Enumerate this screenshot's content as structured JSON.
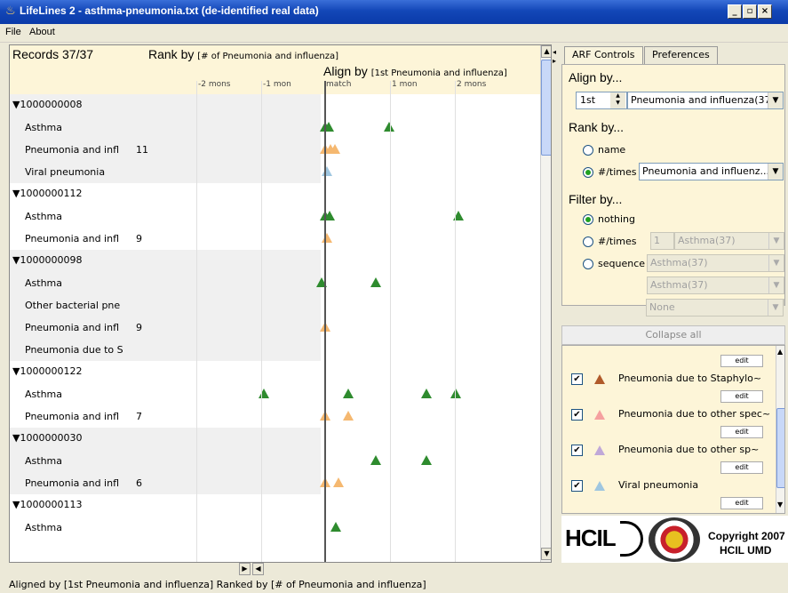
{
  "window": {
    "title": "LifeLines 2 - asthma-pneumonia.txt (de-identified real data)",
    "buttons": [
      "_",
      "×"
    ]
  },
  "menu": [
    "File",
    "About"
  ],
  "header": {
    "records": "Records 37/37",
    "rankby_label": "Rank by",
    "rankby_value": "[# of Pneumonia and influenza]",
    "alignby_label": "Align by",
    "alignby_value": "[1st Pneumonia and influenza]",
    "ticks": [
      "-2 mons",
      "-1 mon",
      "match",
      "1 mon",
      "2 mons"
    ]
  },
  "records": [
    {
      "id": "1000000008",
      "rows": [
        {
          "label": "Asthma",
          "count": "",
          "events": [
            {
              "c": "g",
              "x": 1.0
            },
            {
              "c": "g",
              "x": 1.12
            },
            {
              "c": "g",
              "x": 3.4
            }
          ]
        },
        {
          "label": "Pneumonia and infl",
          "count": "11",
          "events": [
            {
              "c": "o",
              "x": 1.0
            },
            {
              "c": "o",
              "x": 1.2
            },
            {
              "c": "o",
              "x": 1.35
            }
          ]
        },
        {
          "label": "Viral pneumonia",
          "count": "",
          "events": [
            {
              "c": "b",
              "x": 1.05
            }
          ]
        }
      ]
    },
    {
      "id": "1000000112",
      "rows": [
        {
          "label": "Asthma",
          "count": "",
          "events": [
            {
              "c": "g",
              "x": 1.0
            },
            {
              "c": "g",
              "x": 1.15
            },
            {
              "c": "g",
              "x": 6.0
            }
          ]
        },
        {
          "label": "Pneumonia and infl",
          "count": "9",
          "events": [
            {
              "c": "o",
              "x": 1.05
            }
          ]
        }
      ]
    },
    {
      "id": "1000000098",
      "rows": [
        {
          "label": "Asthma",
          "count": "",
          "events": [
            {
              "c": "g",
              "x": 0.85
            },
            {
              "c": "g",
              "x": 2.9
            }
          ]
        },
        {
          "label": "Other bacterial pne",
          "count": "",
          "events": []
        },
        {
          "label": "Pneumonia and infl",
          "count": "9",
          "events": [
            {
              "c": "o",
              "x": 1.0
            }
          ]
        },
        {
          "label": "Pneumonia due to S",
          "count": "",
          "events": []
        }
      ]
    },
    {
      "id": "1000000122",
      "rows": [
        {
          "label": "Asthma",
          "count": "",
          "events": [
            {
              "c": "g",
              "x": -1.3
            },
            {
              "c": "g",
              "x": 1.85
            },
            {
              "c": "g",
              "x": 4.8
            },
            {
              "c": "g",
              "x": 5.9
            }
          ]
        },
        {
          "label": "Pneumonia and infl",
          "count": "7",
          "events": [
            {
              "c": "o",
              "x": 1.0
            },
            {
              "c": "o",
              "x": 1.85
            }
          ]
        }
      ]
    },
    {
      "id": "1000000030",
      "rows": [
        {
          "label": "Asthma",
          "count": "",
          "events": [
            {
              "c": "g",
              "x": 2.9
            },
            {
              "c": "g",
              "x": 4.8
            }
          ]
        },
        {
          "label": "Pneumonia and infl",
          "count": "6",
          "events": [
            {
              "c": "o",
              "x": 1.0
            },
            {
              "c": "o",
              "x": 1.5
            }
          ]
        }
      ]
    },
    {
      "id": "1000000113",
      "rows": [
        {
          "label": "Asthma",
          "count": "",
          "events": [
            {
              "c": "g",
              "x": 1.4
            }
          ]
        }
      ]
    }
  ],
  "status": "Aligned by [1st Pneumonia and influenza]   Ranked by [# of Pneumonia and influenza]",
  "right": {
    "tabs": [
      "ARF Controls",
      "Preferences"
    ],
    "align_title": "Align by...",
    "align_ordinal": "1st",
    "align_event": "Pneumonia and influenza(37)",
    "rank_title": "Rank by...",
    "rank_name": "name",
    "rank_times": "#/times",
    "rank_event": "Pneumonia and influenz...",
    "filter_title": "Filter by...",
    "filter_nothing": "nothing",
    "filter_times": "#/times",
    "filter_times_num": "1",
    "filter_times_event": "Asthma(37)",
    "filter_sequence": "sequence",
    "filter_seq1": "Asthma(37)",
    "filter_seq2": "Asthma(37)",
    "filter_seq3": "None",
    "collapse": "Collapse all",
    "edit": "edit",
    "legend": [
      {
        "label": "Pneumonia due to Staphylo~",
        "color": "#b05a2a"
      },
      {
        "label": "Pneumonia due to other spec~",
        "color": "#f5a0a0"
      },
      {
        "label": "Pneumonia due to other sp~",
        "color": "#c0a8d8"
      },
      {
        "label": "Viral pneumonia",
        "color": "#9fc6e0"
      }
    ],
    "copyright": "Copyright 2007",
    "org": "HCIL UMD",
    "logo_text": "HCIL"
  }
}
